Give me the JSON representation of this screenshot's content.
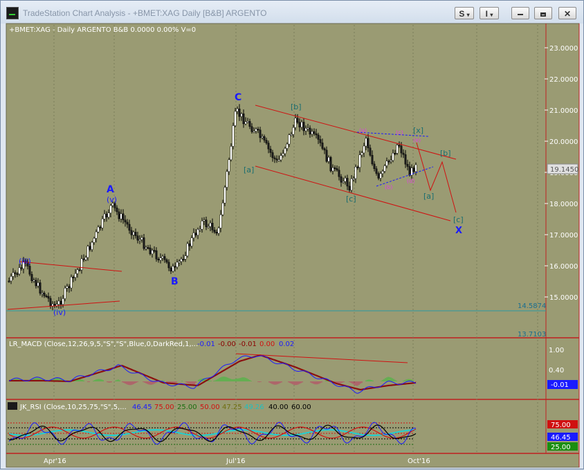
{
  "window": {
    "title": "TradeStation Chart Analysis - +BMET:XAG Daily [B&B] ARGENTO",
    "buttons": [
      {
        "label": "S",
        "icon": "chevron-down-icon"
      },
      {
        "label": "I",
        "icon": "chevron-down-icon"
      }
    ],
    "controls": [
      "minimize-icon",
      "restore-icon",
      "close-icon"
    ]
  },
  "price_panel": {
    "header": "+BMET:XAG - Daily  ARGENTO  B&B  0.0000  0.00%  V=0",
    "axis_labels": [
      "23.0000",
      "22.0000",
      "21.0000",
      "20.0000",
      "19.0000",
      "18.0000",
      "17.0000",
      "16.0000",
      "15.0000"
    ],
    "last_price": "19.1450",
    "marker_high": "14.5874",
    "marker_low": "13.7103",
    "wave_labels": {
      "A": "A",
      "B": "B",
      "C": "C",
      "X": "X",
      "iii": "(iii)",
      "iv": "(iv)",
      "v": "(v)",
      "a_cap": "[a]",
      "b_cap": "[b]",
      "c_cap": "[c]",
      "b_future": "[b]",
      "a_future": "[a]",
      "c_future": "[c]",
      "x_small": "[x]",
      "sa": "(a)",
      "sb": "(b)",
      "sc": "(c)",
      "sd": "(d)",
      "se": "(e)"
    },
    "colors": {
      "background": "#9a9b73",
      "candle": "#ffffff",
      "wave_blue": "#1a1aff",
      "wave_teal": "#1a6e70",
      "wave_magenta": "#e040e0",
      "channel": "#d01010"
    }
  },
  "macd_panel": {
    "header_name": "LR_MACD (Close,12,26,9,5,\"S\",\"S\",Blue,0,DarkRed,1,...",
    "values": [
      "-0.01",
      "-0.00",
      "-0.01",
      "0.00",
      "0.02"
    ],
    "value_colors": [
      "#1a1aff",
      "#8b0000",
      "#8b0000",
      "#d01010",
      "#1a1aff"
    ],
    "axis_labels": [
      "1.00",
      "0.40"
    ],
    "last_value": "-0.01"
  },
  "rsi_panel": {
    "header_name": "JK_RSI (Close,10,25,75,\"S\",5,...",
    "values": [
      "46.45",
      "75.00",
      "25.00",
      "50.00",
      "47.25",
      "49.26",
      "40.00",
      "60.00"
    ],
    "value_colors": [
      "#1a1aff",
      "#d01010",
      "#1a6e10",
      "#d01010",
      "#6e6e10",
      "#20c0c0",
      "#000000",
      "#000000"
    ],
    "tag_upper": "75.00",
    "tag_value": "46.45",
    "tag_lower": "25.00"
  },
  "time_axis": {
    "labels": [
      "Apr'16",
      "Jul'16",
      "Oct'16"
    ]
  }
}
